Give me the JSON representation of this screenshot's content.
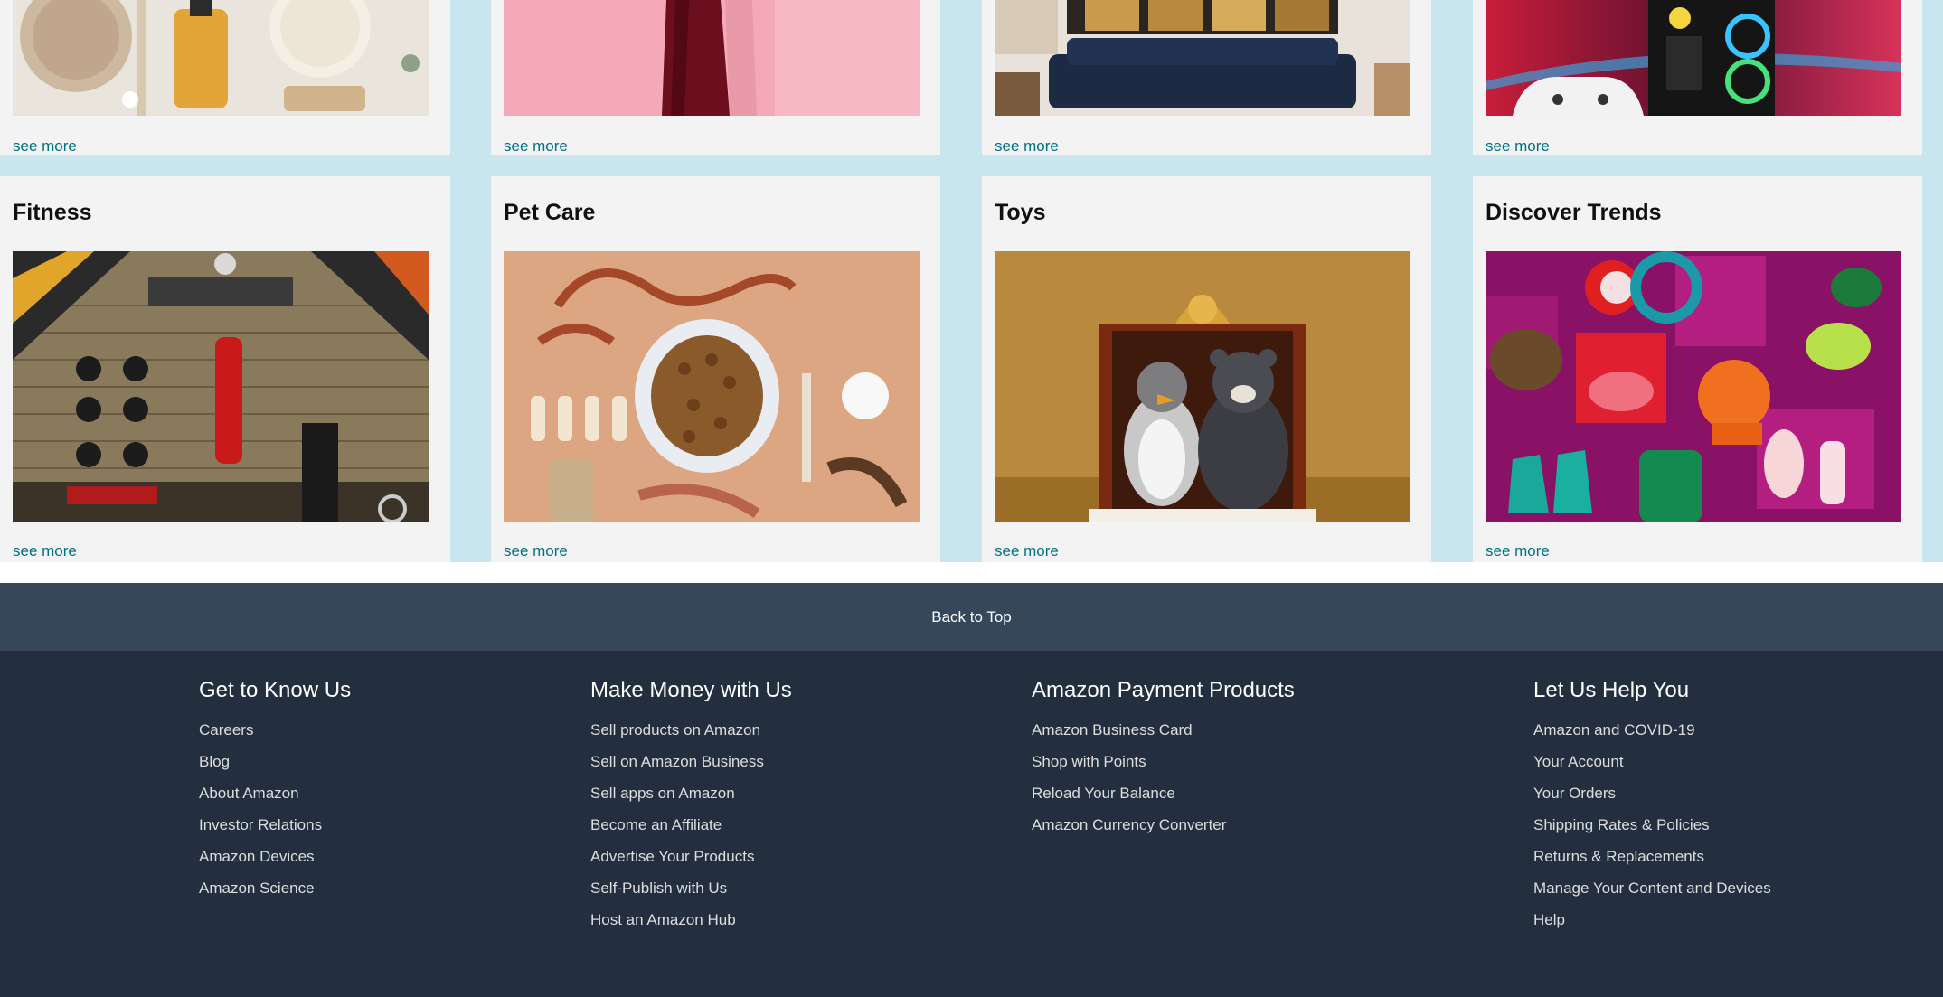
{
  "top_row": {
    "cards": [
      {
        "see_more": "see more",
        "image": "beauty-products-photo"
      },
      {
        "see_more": "see more",
        "image": "fashion-dress-photo"
      },
      {
        "see_more": "see more",
        "image": "home-decor-sofa-photo"
      },
      {
        "see_more": "see more",
        "image": "gaming-pc-photo"
      }
    ]
  },
  "bottom_row": {
    "cards": [
      {
        "title": "Fitness",
        "see_more": "see more",
        "image": "home-gym-photo"
      },
      {
        "title": "Pet Care",
        "see_more": "see more",
        "image": "pet-supplies-photo"
      },
      {
        "title": "Toys",
        "see_more": "see more",
        "image": "plush-toys-gift-box-photo"
      },
      {
        "title": "Discover Trends",
        "see_more": "see more",
        "image": "trend-products-photo"
      }
    ]
  },
  "back_to_top": "Back to Top",
  "footer": {
    "columns": [
      {
        "heading": "Get to Know Us",
        "links": [
          "Careers",
          "Blog",
          "About Amazon",
          "Investor Relations",
          "Amazon Devices",
          "Amazon Science"
        ]
      },
      {
        "heading": "Make Money with Us",
        "links": [
          "Sell products on Amazon",
          "Sell on Amazon Business",
          "Sell apps on Amazon",
          "Become an Affiliate",
          "Advertise Your Products",
          "Self-Publish with Us",
          "Host an Amazon Hub"
        ]
      },
      {
        "heading": "Amazon Payment Products",
        "links": [
          "Amazon Business Card",
          "Shop with Points",
          "Reload Your Balance",
          "Amazon Currency Converter"
        ]
      },
      {
        "heading": "Let Us Help You",
        "links": [
          "Amazon and COVID-19",
          "Your Account",
          "Your Orders",
          "Shipping Rates & Policies",
          "Returns & Replacements",
          "Manage Your Content and Devices",
          "Help"
        ]
      }
    ]
  },
  "colors": {
    "link": "#007185",
    "footer_bg": "#232f3e",
    "back_to_top_bg": "#37475a",
    "page_bg": "#c9e5ee",
    "card_bg": "#f3f3f3"
  }
}
